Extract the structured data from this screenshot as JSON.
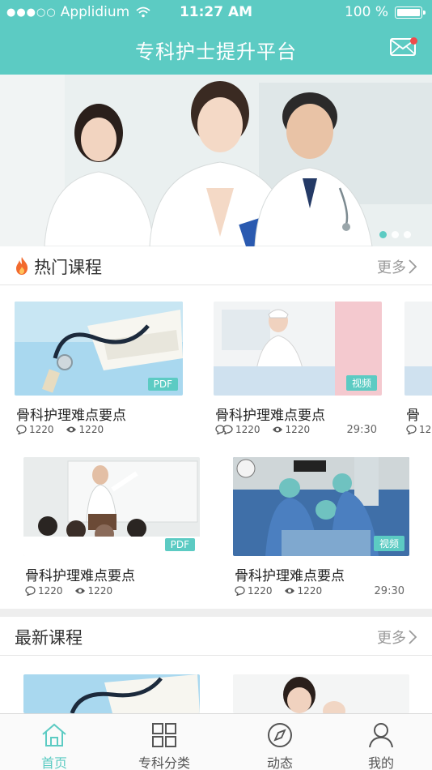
{
  "status_bar": {
    "signal": "●●●○○",
    "carrier": "Applidium",
    "time": "11:27 AM",
    "battery": "100 %"
  },
  "header": {
    "title": "专科护士提升平台",
    "mail_icon": "mail-icon",
    "has_notification": true
  },
  "banner": {
    "slide_count": 3,
    "active_slide": 1
  },
  "hot_courses": {
    "title": "热门课程",
    "more": "更多",
    "items": [
      {
        "title": "骨科护理难点要点",
        "type": "PDF",
        "comments": "1220",
        "views": "1220",
        "duration": ""
      },
      {
        "title": "骨科护理难点要点",
        "type": "视频",
        "comments": "1220",
        "views": "1220",
        "duration": "29:30"
      },
      {
        "title": "骨",
        "type": "",
        "comments": "12",
        "views": "",
        "duration": ""
      },
      {
        "title": "骨科护理难点要点",
        "type": "PDF",
        "comments": "1220",
        "views": "1220",
        "duration": ""
      },
      {
        "title": "骨科护理难点要点",
        "type": "视频",
        "comments": "1220",
        "views": "1220",
        "duration": "29:30"
      }
    ]
  },
  "new_courses": {
    "title": "最新课程",
    "more": "更多"
  },
  "tabbar": {
    "tabs": [
      {
        "label": "首页",
        "icon": "home-icon",
        "active": true
      },
      {
        "label": "专科分类",
        "icon": "grid-icon",
        "active": false
      },
      {
        "label": "动态",
        "icon": "compass-icon",
        "active": false
      },
      {
        "label": "我的",
        "icon": "user-icon",
        "active": false
      }
    ]
  },
  "colors": {
    "accent": "#5ccbc3",
    "notification": "#f04b4b"
  }
}
